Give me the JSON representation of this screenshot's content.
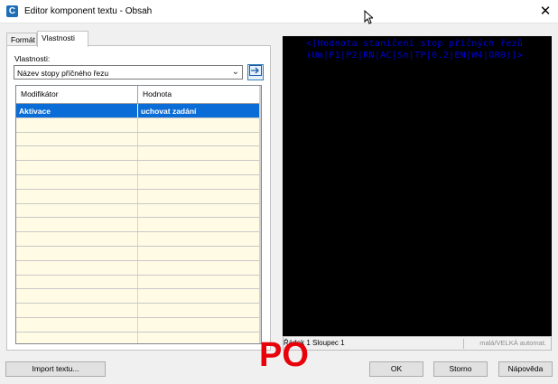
{
  "window": {
    "title": "Editor komponent textu - Obsah",
    "app_icon": "C"
  },
  "tabs": [
    {
      "label": "Formát"
    },
    {
      "label": "Vlastnosti"
    }
  ],
  "properties": {
    "label": "Vlastnosti:",
    "selected": "Název stopy příčného řezu"
  },
  "grid": {
    "columns": [
      "Modifikátor",
      "Hodnota"
    ],
    "rows": [
      {
        "modifier": "Aktivace",
        "value": "uchovat zadání"
      }
    ]
  },
  "editor": {
    "lines": [
      "<[Hodnota staničení stop příčných řezů",
      "(Um|P1|P2|RN|AC|Sn|TP|0.2|EN|W4|OR0)]>"
    ],
    "text_color": "#0000d8",
    "background": "#000000"
  },
  "status": {
    "position": "Řádek 1 Sloupec 1",
    "case_mode": "malá/VELKÁ automat."
  },
  "overlay_text": "PO",
  "buttons": {
    "import": "Import textu...",
    "ok": "OK",
    "cancel": "Storno",
    "help": "Nápověda"
  }
}
